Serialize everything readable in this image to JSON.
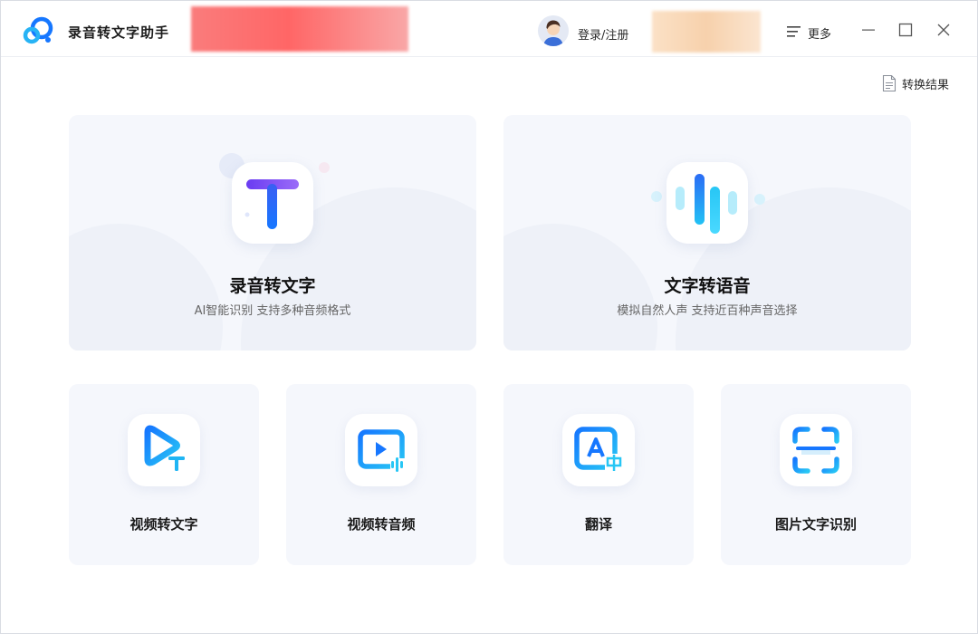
{
  "app": {
    "title": "录音转文字助手"
  },
  "header": {
    "login_label": "登录/注册",
    "more_label": "更多",
    "icons": {
      "logo": "app-logo-icon",
      "avatar": "user-avatar",
      "more": "menu-icon",
      "minimize": "minimize-icon",
      "maximize": "maximize-icon",
      "close": "close-icon"
    }
  },
  "toolbar": {
    "results_label": "转换结果",
    "results_icon": "document-icon"
  },
  "features": {
    "primary": [
      {
        "title": "录音转文字",
        "subtitle": "AI智能识别 支持多种音频格式",
        "icon": "text-t-icon"
      },
      {
        "title": "文字转语音",
        "subtitle": "模拟自然人声 支持近百种声音选择",
        "icon": "sound-wave-icon"
      }
    ],
    "secondary": [
      {
        "label": "视频转文字",
        "icon": "video-to-text-icon"
      },
      {
        "label": "视频转音频",
        "icon": "video-to-audio-icon"
      },
      {
        "label": "翻译",
        "icon": "translate-icon"
      },
      {
        "label": "图片文字识别",
        "icon": "scan-icon"
      }
    ]
  },
  "colors": {
    "accent_blue": "#1677ff",
    "accent_cyan": "#27c6f5",
    "accent_purple": "#6a3cf2",
    "card_bg": "#f5f7fc"
  }
}
